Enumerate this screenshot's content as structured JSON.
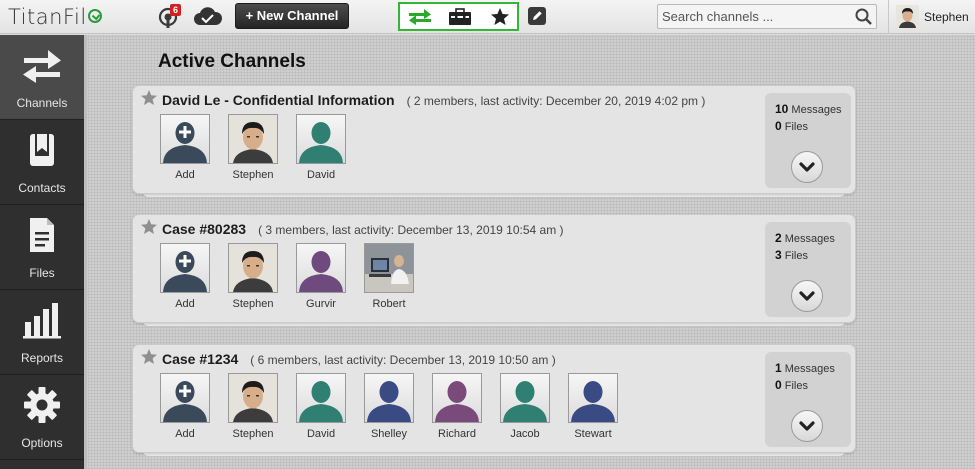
{
  "app": {
    "logo_text": "TitanFil",
    "notifications_count": "6",
    "new_channel_label": "+ New Channel",
    "search_placeholder": "Search channels ...",
    "user_name": "Stephen",
    "accent_green": "#35b535",
    "badge_red": "#d42020"
  },
  "sidebar": {
    "items": [
      {
        "label": "Channels",
        "icon": "swap-arrows-icon",
        "active": true
      },
      {
        "label": "Contacts",
        "icon": "contacts-book-icon",
        "active": false
      },
      {
        "label": "Files",
        "icon": "document-icon",
        "active": false
      },
      {
        "label": "Reports",
        "icon": "bar-chart-icon",
        "active": false
      },
      {
        "label": "Options",
        "icon": "gear-icon",
        "active": false
      }
    ]
  },
  "main": {
    "title": "Active Channels",
    "channels": [
      {
        "title": "David Le - Confidential Information",
        "meta": "( 2 members, last activity: December 20, 2019 4:02 pm )",
        "messages_count": "10",
        "messages_label": "Messages",
        "files_count": "0",
        "files_label": "Files",
        "members": [
          {
            "name": "Add",
            "kind": "add",
            "color": "#3b4a5a"
          },
          {
            "name": "Stephen",
            "kind": "photo",
            "color": "#6b5a4a"
          },
          {
            "name": "David",
            "kind": "silhouette",
            "color": "#2f7f72"
          }
        ]
      },
      {
        "title": "Case #80283",
        "meta": "( 3 members, last activity: December 13, 2019 10:54 am )",
        "messages_count": "2",
        "messages_label": "Messages",
        "files_count": "3",
        "files_label": "Files",
        "members": [
          {
            "name": "Add",
            "kind": "add",
            "color": "#3b4a5a"
          },
          {
            "name": "Stephen",
            "kind": "photo",
            "color": "#6b5a4a"
          },
          {
            "name": "Gurvir",
            "kind": "silhouette",
            "color": "#6e4a7e"
          },
          {
            "name": "Robert",
            "kind": "photo-desk",
            "color": "#7a7f88"
          }
        ]
      },
      {
        "title": "Case #1234",
        "meta": "( 6 members, last activity: December 13, 2019 10:50 am )",
        "messages_count": "1",
        "messages_label": "Messages",
        "files_count": "0",
        "files_label": "Files",
        "members": [
          {
            "name": "Add",
            "kind": "add",
            "color": "#3b4a5a"
          },
          {
            "name": "Stephen",
            "kind": "photo",
            "color": "#6b5a4a"
          },
          {
            "name": "David",
            "kind": "silhouette",
            "color": "#2f7f72"
          },
          {
            "name": "Shelley",
            "kind": "silhouette",
            "color": "#3a4a82"
          },
          {
            "name": "Richard",
            "kind": "silhouette",
            "color": "#7a4a7a"
          },
          {
            "name": "Jacob",
            "kind": "silhouette",
            "color": "#2f7f72"
          },
          {
            "name": "Stewart",
            "kind": "silhouette",
            "color": "#3a4a82"
          }
        ]
      }
    ]
  }
}
